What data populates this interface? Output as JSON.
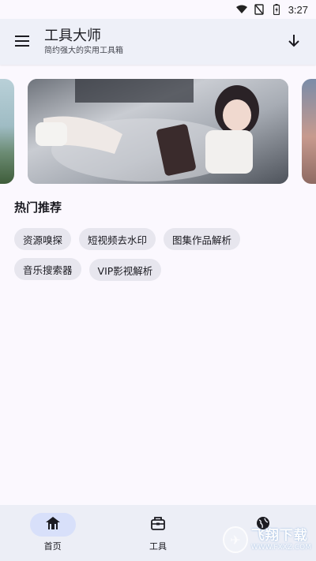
{
  "status_bar": {
    "time": "3:27",
    "icons": [
      "wifi-icon",
      "no-signal-icon",
      "battery-icon"
    ]
  },
  "app_bar": {
    "title": "工具大师",
    "subtitle": "简约强大的实用工具箱",
    "menu_icon": "menu-icon",
    "action_icon": "download-icon"
  },
  "carousel": {
    "slides": [
      "slide-left-landscape",
      "slide-main-photo",
      "slide-right-landscape"
    ],
    "active_index": 1
  },
  "hot": {
    "title": "热门推荐",
    "chips": [
      "资源嗅探",
      "短视频去水印",
      "图集作品解析",
      "音乐搜索器",
      "VIP影视解析"
    ]
  },
  "bottom_nav": {
    "items": [
      {
        "label": "首页",
        "icon": "home-icon",
        "active": true
      },
      {
        "label": "工具",
        "icon": "toolbox-icon",
        "active": false
      },
      {
        "label": "",
        "icon": "globe-icon",
        "active": false
      }
    ]
  },
  "watermark": {
    "main": "飞翔下载",
    "sub": "WWW.FXXZ.COM"
  },
  "colors": {
    "app_bar_bg": "#eef0f8",
    "chip_bg": "#e7e6ee",
    "nav_active_bg": "#d8e0fa",
    "page_bg": "#fbf8fe"
  }
}
